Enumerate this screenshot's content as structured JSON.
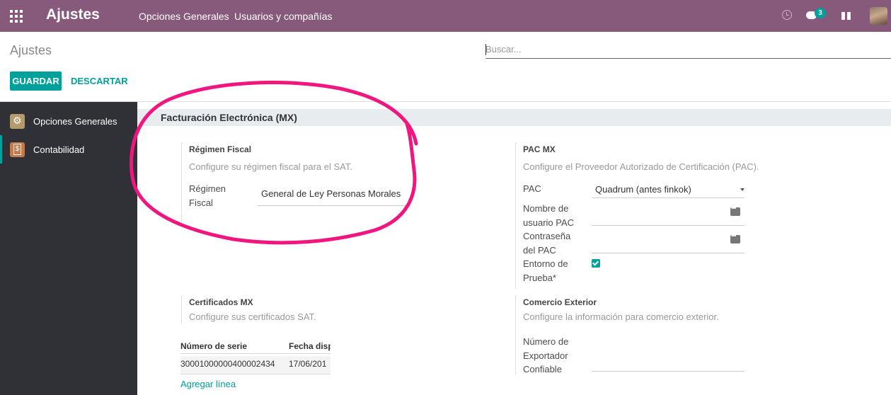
{
  "topbar": {
    "app_title": "Ajustes",
    "nav": [
      "Opciones Generales",
      "Usuarios y compañías"
    ],
    "chat_count": "3",
    "colors": {
      "bar": "#875a7b",
      "accent": "#00a09d"
    }
  },
  "control_panel": {
    "breadcrumb": "Ajustes",
    "search_placeholder": "Buscar...",
    "save_label": "GUARDAR",
    "discard_label": "DESCARTAR"
  },
  "sidebar": {
    "items": [
      {
        "label": "Opciones Generales",
        "icon": "gear-icon"
      },
      {
        "label": "Contabilidad",
        "icon": "accounting-icon"
      }
    ]
  },
  "main": {
    "section_title": "Facturación Electrónica (MX)",
    "regimen": {
      "title": "Régimen Fiscal",
      "desc": "Configure su régimen fiscal para el SAT.",
      "field_label_1": "Régimen",
      "field_label_2": "Fiscal",
      "value": "General de Ley Personas Morales"
    },
    "pac": {
      "title": "PAC MX",
      "desc": "Configure el Proveedor Autorizado de Certificación (PAC).",
      "pac_label": "PAC",
      "pac_value": "Quadrum (antes finkok)",
      "user_label_1": "Nombre de",
      "user_label_2": "usuario PAC",
      "pass_label_1": "Contraseña",
      "pass_label_2": "del PAC",
      "test_label_1": "Entorno de",
      "test_label_2": "Prueba*",
      "test_checked": true
    },
    "certificates": {
      "title": "Certificados MX",
      "desc": "Configure sus certificados SAT.",
      "columns": [
        "Número de serie",
        "Fecha disp"
      ],
      "rows": [
        [
          "30001000000400002434",
          "17/06/201"
        ]
      ],
      "add_line": "Agregar línea"
    },
    "comercio": {
      "title": "Comercio Exterior",
      "desc": "Configure la información para comercio exterior.",
      "label_1": "Número de",
      "label_2": "Exportador",
      "label_3": "Confiable"
    }
  }
}
